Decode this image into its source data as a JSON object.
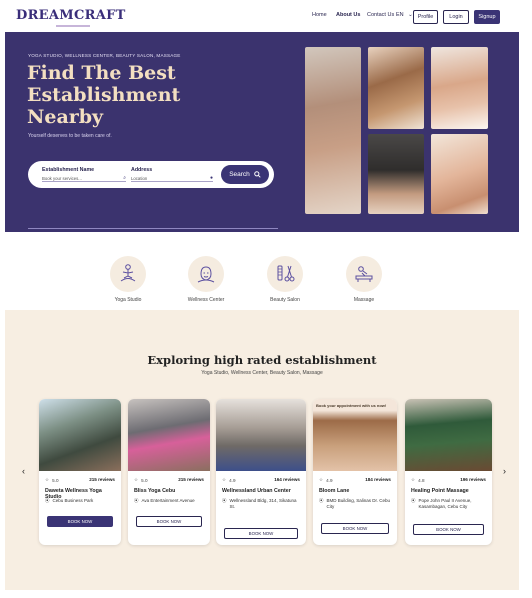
{
  "header": {
    "logo": "DREAMCRAFT",
    "nav": [
      "Home",
      "About Us",
      "Contact Us"
    ],
    "language": "EN",
    "buttons": {
      "profile": "Profile",
      "login": "Login",
      "signup": "Signup"
    }
  },
  "hero": {
    "eyebrow": "YOGA STUDIO, WELLNESS CENTER, BEAUTY SALON, MASSAGE",
    "title_lines": [
      "Find The Best",
      "Establishment",
      "Nearby"
    ],
    "subtitle": "Yourself deserves to be taken care of.",
    "search": {
      "establishment_label": "Establishment Name",
      "establishment_placeholder": "Book your services...",
      "address_label": "Address",
      "address_placeholder": "Location",
      "button": "Search"
    }
  },
  "categories": [
    {
      "label": "Yoga Studio",
      "icon": "yoga-icon"
    },
    {
      "label": "Wellness Center",
      "icon": "wellness-icon"
    },
    {
      "label": "Beauty Salon",
      "icon": "salon-icon"
    },
    {
      "label": "Massage",
      "icon": "massage-icon"
    }
  ],
  "featured": {
    "title": "Exploring high rated establishment",
    "subtitle": "Yoga Studio, Wellness Center, Beauty Salon, Massage",
    "cards": [
      {
        "rating": "5.0",
        "reviews": "215 reviews",
        "name": "Daweta Wellness Yoga Studio",
        "location": "Cebu Business Park",
        "button": "BOOK NOW"
      },
      {
        "rating": "5.0",
        "reviews": "215 reviews",
        "name": "Bliss Yoga Cebu",
        "location": "Ava Entertainment Avenue",
        "button": "BOOK NOW"
      },
      {
        "rating": "4.9",
        "reviews": "164 reviews",
        "name": "Wellnessland Urban Center",
        "location": "Wellnessland Bldg, 314, Sikatuna St.",
        "button": "BOOK NOW"
      },
      {
        "rating": "4.9",
        "reviews": "184 reviews",
        "name": "Bloom Lane",
        "location": "BMD Building, Salinas Dr. Cebu City",
        "button": "BOOK NOW",
        "banner": "Book your appointment with us now!"
      },
      {
        "rating": "4.8",
        "reviews": "196 reviews",
        "name": "Healing Point Massage",
        "location": "Pope John Paul II Avenue, Kasambagan, Cebu City",
        "button": "BOOK NOW"
      }
    ]
  },
  "colors": {
    "brand": "#3b336e",
    "accent": "#f3dfc1",
    "section_bg": "#f7eee2"
  }
}
